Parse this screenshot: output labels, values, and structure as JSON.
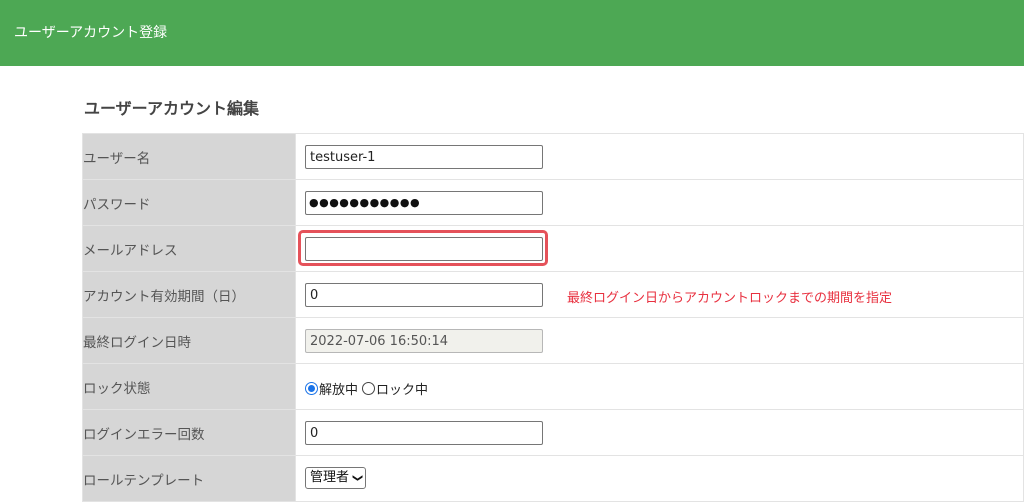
{
  "header": {
    "title": "ユーザーアカウント登録"
  },
  "section": {
    "title": "ユーザーアカウント編集"
  },
  "form": {
    "username": {
      "label": "ユーザー名",
      "value": "testuser-1"
    },
    "password": {
      "label": "パスワード",
      "value": "●●●●●●●●●●●"
    },
    "email": {
      "label": "メールアドレス",
      "value": ""
    },
    "expiry": {
      "label": "アカウント有効期間（日）",
      "value": "0",
      "note": "最終ログイン日からアカウントロックまでの期間を指定"
    },
    "last_login": {
      "label": "最終ログイン日時",
      "value": "2022-07-06 16:50:14"
    },
    "lock": {
      "label": "ロック状態",
      "options": [
        "解放中",
        "ロック中"
      ],
      "selected": "解放中"
    },
    "login_errors": {
      "label": "ログインエラー回数",
      "value": "0"
    },
    "role": {
      "label": "ロールテンプレート",
      "value": "管理者"
    }
  },
  "colors": {
    "header": "#4da854",
    "highlight": "#e5525a",
    "note": "#e8303f",
    "label_bg": "#d6d6d6"
  }
}
